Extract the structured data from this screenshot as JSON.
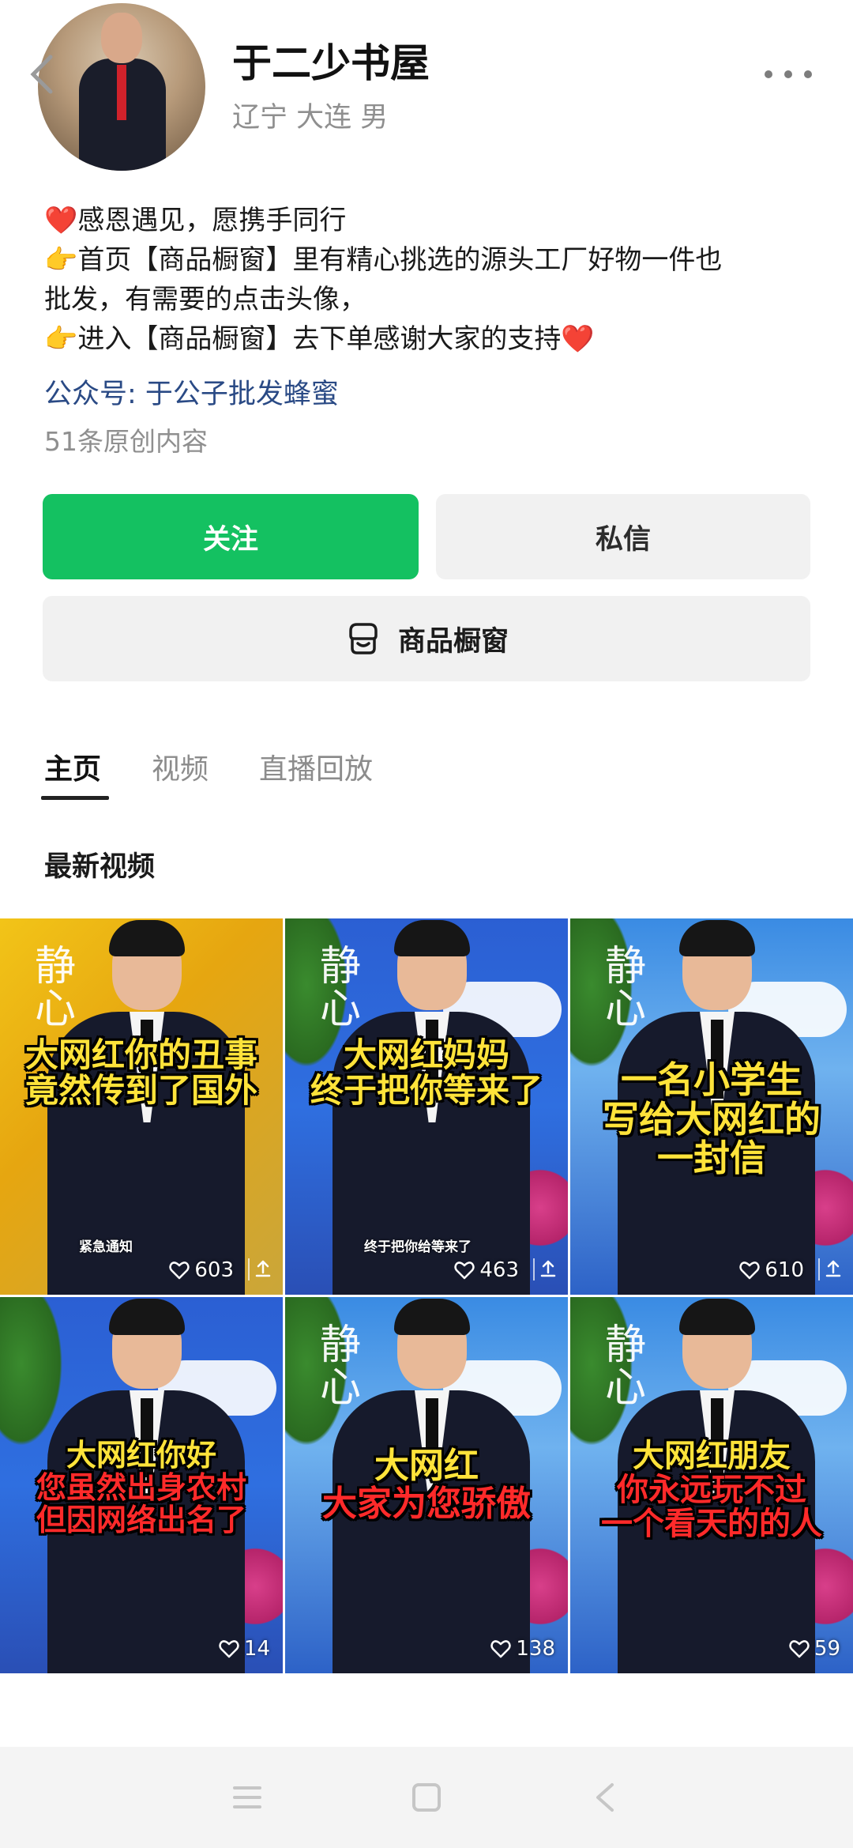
{
  "profile": {
    "name": "于二少书屋",
    "location": "辽宁 大连 男",
    "bio_lines": [
      "❤️感恩遇见，愿携手同行",
      "👉首页【商品橱窗】里有精心挑选的源头工厂好物一件也",
      "批发，有需要的点击头像，",
      "👉进入【商品橱窗】去下单感谢大家的支持❤️"
    ],
    "wechat": "公众号: 于公子批发蜂蜜",
    "original_count": "51条原创内容"
  },
  "actions": {
    "follow": "关注",
    "message": "私信",
    "shop": "商品橱窗"
  },
  "tabs": [
    "主页",
    "视频",
    "直播回放"
  ],
  "section_title": "最新视频",
  "videos": [
    {
      "overlay": [
        "大网红你的丑事",
        "竟然传到了国外"
      ],
      "caption": "紧急通知",
      "likes": "603",
      "share": true,
      "watermark": "静心"
    },
    {
      "overlay": [
        "大网红妈妈",
        "终于把你等来了"
      ],
      "caption": "终于把你给等来了",
      "likes": "463",
      "share": true,
      "watermark": "静心"
    },
    {
      "overlay": [
        "一名小学生",
        "写给大网红的",
        "一封信"
      ],
      "caption": "",
      "likes": "610",
      "share": true,
      "watermark": "静心"
    },
    {
      "overlay": [
        "大网红你好",
        "您虽然出身农村",
        "但因网络出名了"
      ],
      "caption": "",
      "likes": "14",
      "share": false,
      "watermark": ""
    },
    {
      "overlay": [
        "大网红",
        "大家为您骄傲"
      ],
      "caption": "",
      "likes": "138",
      "share": false,
      "watermark": "静心"
    },
    {
      "overlay": [
        "大网红朋友",
        "你永远玩不过",
        "一个看天的的人"
      ],
      "caption": "",
      "likes": "59",
      "share": false,
      "watermark": "静心"
    }
  ],
  "colors": {
    "follow_green": "#14c161",
    "link_blue": "#2a4a85",
    "overlay_yellow": "#ffe33a",
    "overlay_red": "#ff2a2a"
  },
  "icons": {
    "back": "chevron-left-icon",
    "more": "more-dots-icon",
    "shop": "shop-bag-icon",
    "likes": "heart-icon",
    "share": "share-icon",
    "nav": [
      "menu-icon",
      "home-square-icon",
      "back-triangle-icon"
    ]
  }
}
